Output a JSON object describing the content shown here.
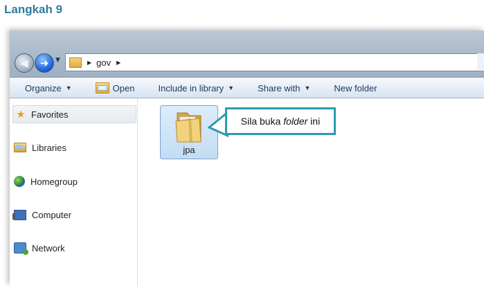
{
  "step": {
    "title": "Langkah 9"
  },
  "address_bar": {
    "segments": [
      "gov"
    ]
  },
  "toolbar": {
    "organize": "Organize",
    "open": "Open",
    "include_in_library": "Include in library",
    "share_with": "Share with",
    "new_folder": "New folder"
  },
  "sidebar": {
    "items": [
      {
        "label": "Favorites",
        "icon": "star-icon"
      },
      {
        "label": "Libraries",
        "icon": "libraries-icon"
      },
      {
        "label": "Homegroup",
        "icon": "homegroup-icon"
      },
      {
        "label": "Computer",
        "icon": "computer-icon"
      },
      {
        "label": "Network",
        "icon": "network-icon"
      }
    ]
  },
  "content": {
    "items": [
      {
        "label": "jpa",
        "icon": "folder-icon",
        "selected": true
      }
    ]
  },
  "callout": {
    "prefix": "Sila buka ",
    "emphasis": "folder",
    "suffix": " ini",
    "border_color": "#2b9ab1"
  },
  "colors": {
    "title": "#2d7da0",
    "toolbar_text": "#1e395b",
    "selection": "#cde3f7"
  }
}
